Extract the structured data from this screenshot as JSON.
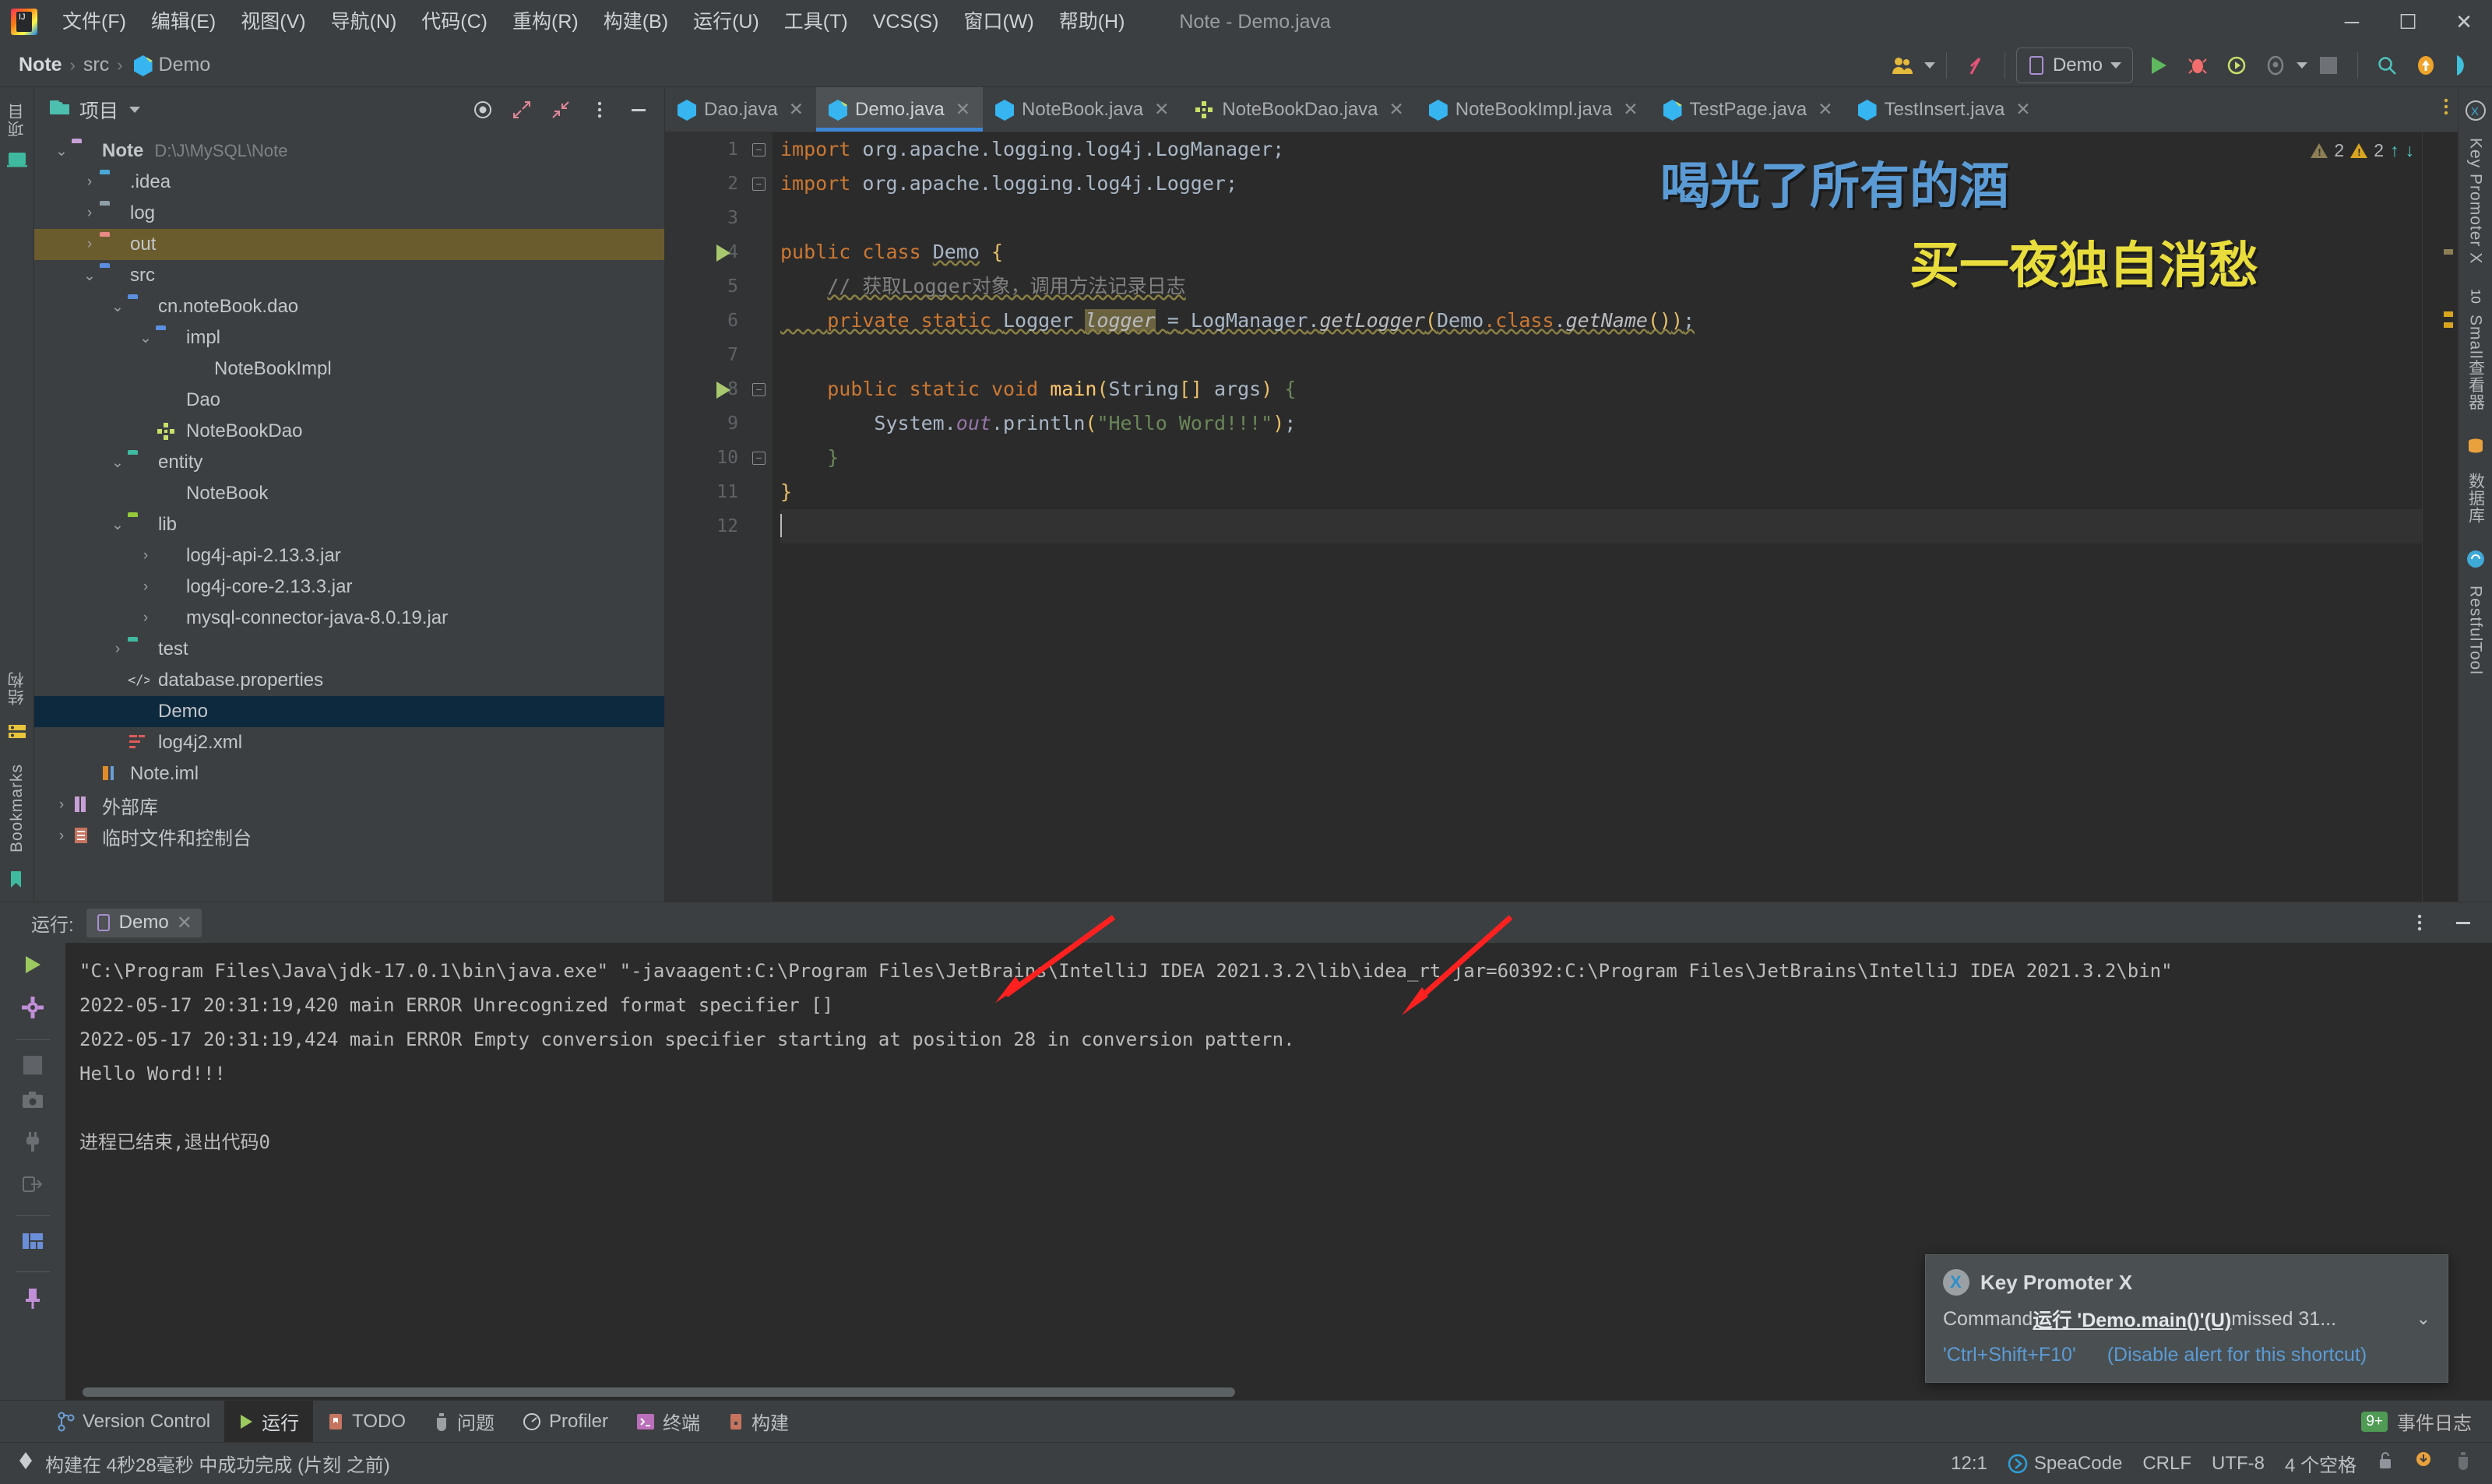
{
  "window": {
    "title": "Note - Demo.java",
    "controls": {
      "minimize": "–",
      "maximize": "❐",
      "close": "✕"
    }
  },
  "menubar": {
    "items": [
      {
        "label": "文件(F)"
      },
      {
        "label": "编辑(E)"
      },
      {
        "label": "视图(V)"
      },
      {
        "label": "导航(N)"
      },
      {
        "label": "代码(C)"
      },
      {
        "label": "重构(R)"
      },
      {
        "label": "构建(B)"
      },
      {
        "label": "运行(U)"
      },
      {
        "label": "工具(T)"
      },
      {
        "label": "VCS(S)"
      },
      {
        "label": "窗口(W)"
      },
      {
        "label": "帮助(H)"
      }
    ]
  },
  "navbar": {
    "breadcrumb": [
      "Note",
      "src",
      "Demo"
    ],
    "run_config": "Demo",
    "icons": [
      "people-icon",
      "branch-icon",
      "run-icon",
      "debug-icon",
      "run-coverage-icon",
      "profiler-icon",
      "stop-icon",
      "search-icon",
      "update-project-icon",
      "ide-icon"
    ]
  },
  "left_stripe": {
    "top": [
      {
        "label": "项目",
        "icon": "project-icon"
      }
    ],
    "bottom": [
      {
        "label": "结构",
        "icon": "structure-icon"
      },
      {
        "label": "Bookmarks",
        "icon": "bookmark-icon"
      }
    ]
  },
  "right_stripe": {
    "items": [
      {
        "label": "Key Promoter X",
        "icon": "key-promoter-icon"
      },
      {
        "label": "Small查看器",
        "icon": "small-viewer-icon"
      },
      {
        "label": "数据库",
        "icon": "database-icon"
      },
      {
        "label": "RestfulTool",
        "icon": "restful-icon"
      }
    ]
  },
  "project_panel": {
    "title": "项目",
    "actions": [
      "locate-icon",
      "expand-all-icon",
      "collapse-all-icon",
      "more-options-icon",
      "hide-icon"
    ],
    "tree": [
      {
        "depth": 0,
        "arrow": "⌄",
        "icon": "folder",
        "color": "#c7a0d8",
        "label": "Note",
        "bold": true,
        "path": "D:\\J\\MySQL\\Note"
      },
      {
        "depth": 1,
        "arrow": "›",
        "icon": "folder-idea",
        "color": "#4aa8d8",
        "label": ".idea"
      },
      {
        "depth": 1,
        "arrow": "›",
        "icon": "folder-log",
        "color": "#8f9fa8",
        "label": "log"
      },
      {
        "depth": 1,
        "arrow": "›",
        "icon": "folder-out",
        "color": "#e88a86",
        "label": "out",
        "highlight": true
      },
      {
        "depth": 1,
        "arrow": "⌄",
        "icon": "folder-src",
        "color": "#5b8fe0",
        "label": "src"
      },
      {
        "depth": 2,
        "arrow": "⌄",
        "icon": "folder-pkg",
        "color": "#5b8fe0",
        "label": "cn.noteBook.dao"
      },
      {
        "depth": 3,
        "arrow": "⌄",
        "icon": "folder-pkg",
        "color": "#5b8fe0",
        "label": "impl"
      },
      {
        "depth": 4,
        "arrow": "",
        "icon": "class",
        "label": "NoteBookImpl"
      },
      {
        "depth": 3,
        "arrow": "",
        "icon": "class",
        "label": "Dao"
      },
      {
        "depth": 3,
        "arrow": "",
        "icon": "interface",
        "label": "NoteBookDao"
      },
      {
        "depth": 2,
        "arrow": "⌄",
        "icon": "folder-entity",
        "color": "#3fb9a0",
        "label": "entity"
      },
      {
        "depth": 3,
        "arrow": "",
        "icon": "class",
        "label": "NoteBook"
      },
      {
        "depth": 2,
        "arrow": "⌄",
        "icon": "folder-lib",
        "color": "#95c83c",
        "label": "lib"
      },
      {
        "depth": 3,
        "arrow": "›",
        "icon": "jar",
        "label": "log4j-api-2.13.3.jar"
      },
      {
        "depth": 3,
        "arrow": "›",
        "icon": "jar",
        "label": "log4j-core-2.13.3.jar"
      },
      {
        "depth": 3,
        "arrow": "›",
        "icon": "jar",
        "label": "mysql-connector-java-8.0.19.jar"
      },
      {
        "depth": 2,
        "arrow": "›",
        "icon": "folder-test",
        "color": "#3fb9a0",
        "label": "test"
      },
      {
        "depth": 2,
        "arrow": "",
        "icon": "properties",
        "label": "database.properties"
      },
      {
        "depth": 2,
        "arrow": "",
        "icon": "class-run",
        "label": "Demo",
        "selected": true
      },
      {
        "depth": 2,
        "arrow": "",
        "icon": "xml",
        "label": "log4j2.xml"
      },
      {
        "depth": 1,
        "arrow": "",
        "icon": "iml",
        "label": "Note.iml"
      },
      {
        "depth": 0,
        "arrow": "›",
        "icon": "ext-lib",
        "label": "外部库"
      },
      {
        "depth": 0,
        "arrow": "›",
        "icon": "scratch",
        "label": "临时文件和控制台"
      }
    ]
  },
  "editor": {
    "tabs": [
      {
        "label": "Dao.java",
        "icon": "class",
        "active": false
      },
      {
        "label": "Demo.java",
        "icon": "class-run",
        "active": true
      },
      {
        "label": "NoteBook.java",
        "icon": "class",
        "active": false
      },
      {
        "label": "NoteBookDao.java",
        "icon": "interface",
        "active": false
      },
      {
        "label": "NoteBookImpl.java",
        "icon": "class",
        "active": false
      },
      {
        "label": "TestPage.java",
        "icon": "class-run",
        "active": false
      },
      {
        "label": "TestInsert.java",
        "icon": "class",
        "active": false
      }
    ],
    "line_numbers": [
      "1",
      "2",
      "3",
      "4",
      "5",
      "6",
      "7",
      "8",
      "9",
      "10",
      "11",
      "12"
    ],
    "code_lines": [
      "import org.apache.logging.log4j.LogManager;",
      "import org.apache.logging.log4j.Logger;",
      "",
      "public class Demo {",
      "    // 获取Logger对象，调用方法记录日志",
      "    private static Logger logger = LogManager.getLogger(Demo.class.getName());",
      "",
      "    public static void main(String[] args) {",
      "        System.out.println(\"Hello Word!!!\");",
      "    }",
      "}",
      ""
    ],
    "inspections": {
      "gray_count": "2",
      "yellow_count": "2"
    },
    "overlay_text": {
      "line1": "喝光了所有的酒",
      "line1_color": "#5b9bd5",
      "line2": "买一夜独自消愁",
      "line2_color": "#e8dd3c"
    }
  },
  "run_panel": {
    "title": "运行:",
    "tab": "Demo",
    "tool_icons": [
      "rerun-icon",
      "settings-icon",
      "stop-icon",
      "screenshot-icon",
      "plug-icon",
      "export-icon",
      "layout-icon",
      "pin-icon"
    ],
    "console_lines": [
      "\"C:\\Program Files\\Java\\jdk-17.0.1\\bin\\java.exe\" \"-javaagent:C:\\Program Files\\JetBrains\\IntelliJ IDEA 2021.3.2\\lib\\idea_rt.jar=60392:C:\\Program Files\\JetBrains\\IntelliJ IDEA 2021.3.2\\bin\"",
      "2022-05-17 20:31:19,420 main ERROR Unrecognized format specifier []",
      "2022-05-17 20:31:19,424 main ERROR Empty conversion specifier starting at position 28 in conversion pattern.",
      "Hello Word!!!",
      "",
      "进程已结束,退出代码0"
    ]
  },
  "notification": {
    "title": "Key Promoter X",
    "message_prefix": "Command ",
    "message_command": "运行 'Demo.main()'(U)",
    "message_suffix": " missed 31...",
    "shortcut": "'Ctrl+Shift+F10'",
    "disable_link": "(Disable alert for this shortcut)"
  },
  "toolwindow_bar": {
    "items": [
      {
        "label": "Version Control",
        "icon": "vcs-icon",
        "active": false
      },
      {
        "label": "运行",
        "icon": "run-icon",
        "active": true
      },
      {
        "label": "TODO",
        "icon": "todo-icon",
        "active": false
      },
      {
        "label": "问题",
        "icon": "problems-icon",
        "active": false
      },
      {
        "label": "Profiler",
        "icon": "profiler-icon",
        "active": false
      },
      {
        "label": "终端",
        "icon": "terminal-icon",
        "active": false
      },
      {
        "label": "构建",
        "icon": "build-icon",
        "active": false
      }
    ],
    "event_log": {
      "badge": "9+",
      "label": "事件日志"
    }
  },
  "statusbar": {
    "message": "构建在 4秒28毫秒 中成功完成 (片刻 之前)",
    "caret_position": "12:1",
    "plugin": "SpeaCode",
    "line_separator": "CRLF",
    "encoding": "UTF-8",
    "indent": "4 个空格",
    "icons": [
      "lock-icon",
      "notifications-icon",
      "inspector-icon"
    ]
  }
}
